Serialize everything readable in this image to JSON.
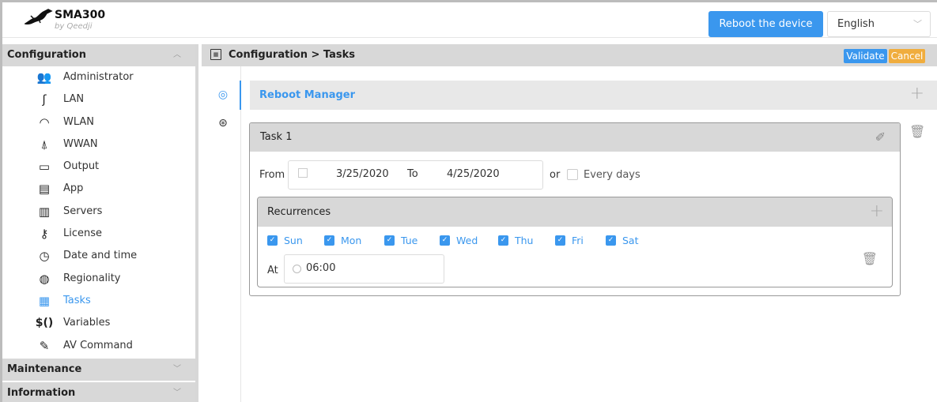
{
  "header": {
    "logo_title": "SMA300",
    "logo_subtitle": "by Qeedji",
    "reboot_button": "Reboot the device",
    "language": "English"
  },
  "sidebar": {
    "config_header": "Configuration",
    "items": [
      {
        "label": "Administrator",
        "icon": "users-icon"
      },
      {
        "label": "LAN",
        "icon": "lan-icon"
      },
      {
        "label": "WLAN",
        "icon": "wifi-icon"
      },
      {
        "label": "WWAN",
        "icon": "antenna-icon"
      },
      {
        "label": "Output",
        "icon": "monitor-icon"
      },
      {
        "label": "App",
        "icon": "app-icon"
      },
      {
        "label": "Servers",
        "icon": "server-icon"
      },
      {
        "label": "License",
        "icon": "key-icon"
      },
      {
        "label": "Date and time",
        "icon": "clock-icon"
      },
      {
        "label": "Regionality",
        "icon": "globe-icon"
      },
      {
        "label": "Tasks",
        "icon": "calendar-icon",
        "active": true
      },
      {
        "label": "Variables",
        "icon": "variables-icon"
      },
      {
        "label": "AV Command",
        "icon": "remote-icon"
      }
    ],
    "maintenance_header": "Maintenance",
    "information_header": "Information"
  },
  "breadcrumb": "Configuration > Tasks",
  "actions": {
    "validate": "Validate",
    "cancel": "Cancel"
  },
  "section": {
    "title": "Reboot Manager"
  },
  "task": {
    "title": "Task 1",
    "from_label": "From",
    "from_date": "3/25/2020",
    "to_label": "To",
    "to_date": "4/25/2020",
    "or_label": "or",
    "every_days_label": "Every days",
    "every_days_checked": false
  },
  "recurrences": {
    "title": "Recurrences",
    "days": [
      {
        "label": "Sun",
        "checked": true
      },
      {
        "label": "Mon",
        "checked": true
      },
      {
        "label": "Tue",
        "checked": true
      },
      {
        "label": "Wed",
        "checked": true
      },
      {
        "label": "Thu",
        "checked": true
      },
      {
        "label": "Fri",
        "checked": true
      },
      {
        "label": "Sat",
        "checked": true
      }
    ],
    "at_label": "At",
    "time": "06:00"
  },
  "colors": {
    "accent": "#3a97ee",
    "cancel": "#f0ad3e",
    "bar": "#d8d8d8"
  }
}
